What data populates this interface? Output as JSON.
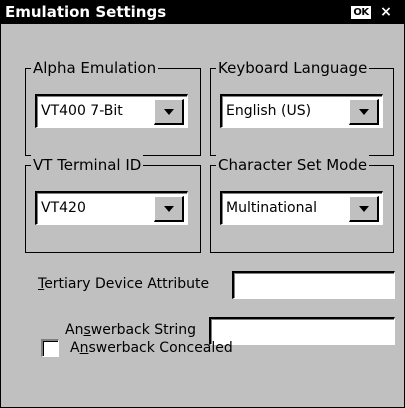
{
  "window": {
    "title": "Emulation Settings",
    "ok_label": "OK",
    "close_label": "×"
  },
  "alpha_emulation": {
    "legend": "Alpha Emulation",
    "value": "VT400 7-Bit"
  },
  "keyboard_language": {
    "legend": "Keyboard Language",
    "value": "English (US)"
  },
  "vt_terminal_id": {
    "legend": "VT Terminal ID",
    "value": "VT420"
  },
  "character_set_mode": {
    "legend": "Character Set Mode",
    "value": "Multinational"
  },
  "tertiary_device_attribute": {
    "label_mnemonic": "T",
    "label_rest": "ertiary Device Attribute",
    "value": ""
  },
  "answerback_string": {
    "label_pre": "An",
    "label_mnemonic": "s",
    "label_rest": "werback String",
    "value": ""
  },
  "answerback_concealed": {
    "label_pre": "A",
    "label_mnemonic": "n",
    "label_rest": "swerback Concealed",
    "checked": false
  }
}
